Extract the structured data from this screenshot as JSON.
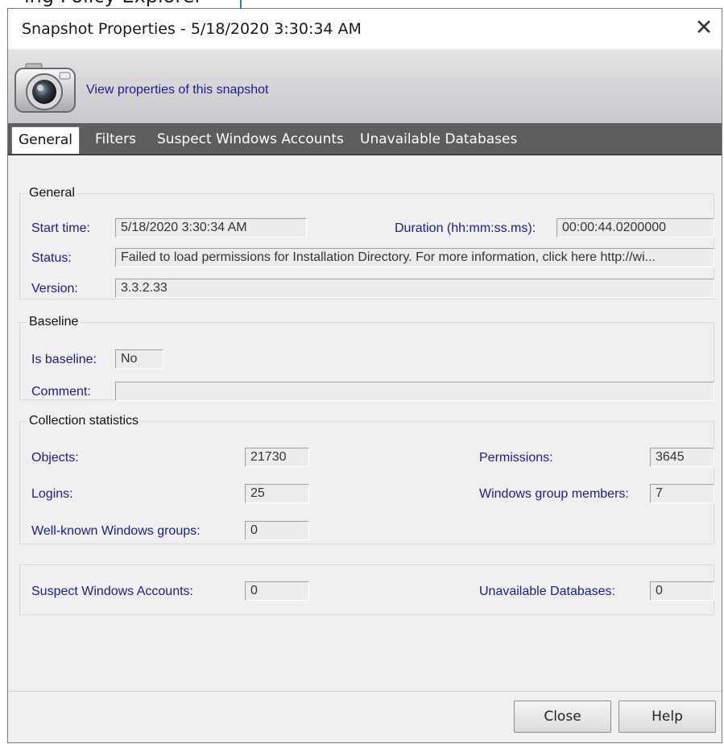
{
  "background_partial_text": "ing Policy Explorer",
  "dialog": {
    "title": "Snapshot Properties - 5/18/2020 3:30:34 AM",
    "close_symbol": "✕"
  },
  "banner": {
    "icon": "camera-icon",
    "text": "View properties of this snapshot"
  },
  "tabs": [
    {
      "label": "General",
      "active": true
    },
    {
      "label": "Filters",
      "active": false
    },
    {
      "label": "Suspect Windows Accounts",
      "active": false
    },
    {
      "label": "Unavailable Databases",
      "active": false
    }
  ],
  "general": {
    "legend": "General",
    "start_time_label": "Start time:",
    "start_time_value": "5/18/2020 3:30:34 AM",
    "duration_label": "Duration (hh:mm:ss.ms):",
    "duration_value": "00:00:44.0200000",
    "status_label": "Status:",
    "status_value": "Failed to load permissions for Installation Directory. For more information, click here http://wi...",
    "version_label": "Version:",
    "version_value": "3.3.2.33"
  },
  "baseline": {
    "legend": "Baseline",
    "is_baseline_label": "Is baseline:",
    "is_baseline_value": "No",
    "comment_label": "Comment:",
    "comment_value": ""
  },
  "stats": {
    "legend": "Collection statistics",
    "objects_label": "Objects:",
    "objects_value": "21730",
    "permissions_label": "Permissions:",
    "permissions_value": "3645",
    "logins_label": "Logins:",
    "logins_value": "25",
    "wgm_label": "Windows group members:",
    "wgm_value": "7",
    "wkwg_label": "Well-known Windows groups:",
    "wkwg_value": "0"
  },
  "summary": {
    "suspect_label": "Suspect Windows Accounts:",
    "suspect_value": "0",
    "unavailable_label": "Unavailable Databases:",
    "unavailable_value": "0"
  },
  "buttons": {
    "close": "Close",
    "help": "Help"
  }
}
